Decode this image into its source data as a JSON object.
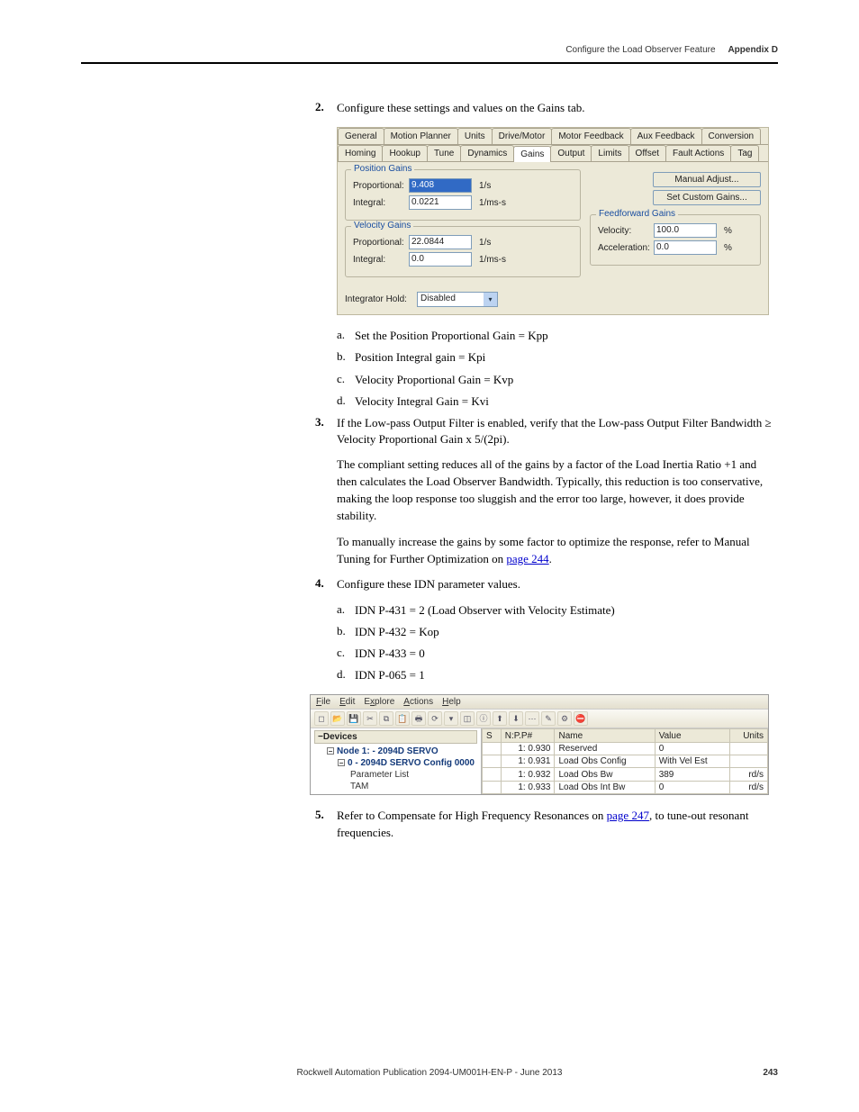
{
  "header": {
    "title": "Configure the Load Observer Feature",
    "section": "Appendix D"
  },
  "step2": {
    "num": "2.",
    "text": "Configure these settings and values on the Gains tab.",
    "a": {
      "label": "a.",
      "text": "Set the Position Proportional Gain = Kpp"
    },
    "b": {
      "label": "b.",
      "text": "Position Integral gain = Kpi"
    },
    "c": {
      "label": "c.",
      "text": "Velocity Proportional Gain = Kvp"
    },
    "d": {
      "label": "d.",
      "text": "Velocity Integral Gain = Kvi"
    }
  },
  "dlg1": {
    "tabs_row1": [
      "General",
      "Motion Planner",
      "Units",
      "Drive/Motor",
      "Motor Feedback",
      "Aux Feedback",
      "Conversion"
    ],
    "tabs_row2": [
      "Homing",
      "Hookup",
      "Tune",
      "Dynamics",
      "Gains",
      "Output",
      "Limits",
      "Offset",
      "Fault Actions",
      "Tag"
    ],
    "active_tab": "Gains",
    "pos": {
      "legend": "Position Gains",
      "prop_label": "Proportional:",
      "prop_value": "9.408",
      "prop_unit": "1/s",
      "int_label": "Integral:",
      "int_value": "0.0221",
      "int_unit": "1/ms-s"
    },
    "vel": {
      "legend": "Velocity Gains",
      "prop_label": "Proportional:",
      "prop_value": "22.0844",
      "prop_unit": "1/s",
      "int_label": "Integral:",
      "int_value": "0.0",
      "int_unit": "1/ms-s"
    },
    "btns": {
      "manual": "Manual Adjust...",
      "custom": "Set Custom Gains..."
    },
    "ff": {
      "legend": "Feedforward Gains",
      "vel_label": "Velocity:",
      "vel_value": "100.0",
      "vel_unit": "%",
      "acc_label": "Acceleration:",
      "acc_value": "0.0",
      "acc_unit": "%"
    },
    "ihold": {
      "label": "Integrator Hold:",
      "value": "Disabled"
    }
  },
  "step3": {
    "num": "3.",
    "text": "If the Low-pass Output Filter is enabled, verify that the Low-pass Output Filter Bandwidth ≥ Velocity Proportional Gain x 5/(2pi).",
    "p2": "The compliant setting reduces all of the gains by a factor of the Load Inertia Ratio +1 and then calculates the Load Observer Bandwidth. Typically, this reduction is too conservative, making the loop response too sluggish and the error too large, however, it does provide stability.",
    "p3_pre": "To manually increase the gains by some factor to optimize the response, refer to Manual Tuning for Further Optimization on ",
    "p3_link": "page 244",
    "p3_post": "."
  },
  "step4": {
    "num": "4.",
    "text": "Configure these IDN parameter values.",
    "a": {
      "label": "a.",
      "text": "IDN P-431 = 2 (Load Observer with Velocity Estimate)"
    },
    "b": {
      "label": "b.",
      "text": "IDN P-432 = Kop"
    },
    "c": {
      "label": "c.",
      "text": "IDN P-433 = 0"
    },
    "d": {
      "label": "d.",
      "text": "IDN P-065 = 1"
    }
  },
  "dlg2": {
    "menus": [
      "File",
      "Edit",
      "Explore",
      "Actions",
      "Help"
    ],
    "tree_head": "Devices",
    "tree": {
      "n1": "Node 1: - 2094D SERVO",
      "n2": "0  - 2094D SERVO Config 0000",
      "n3": "Parameter List",
      "n4": "TAM"
    },
    "cols": {
      "s": "S",
      "np": "N:P.P#",
      "name": "Name",
      "value": "Value",
      "units": "Units"
    },
    "rows": [
      {
        "np": "1: 0.930",
        "name": "Reserved",
        "value": "0",
        "units": ""
      },
      {
        "np": "1: 0.931",
        "name": "Load Obs Config",
        "value": "With Vel Est",
        "units": ""
      },
      {
        "np": "1: 0.932",
        "name": "Load Obs Bw",
        "value": "389",
        "units": "rd/s"
      },
      {
        "np": "1: 0.933",
        "name": "Load Obs Int Bw",
        "value": "0",
        "units": "rd/s"
      }
    ]
  },
  "step5": {
    "num": "5.",
    "pre": "Refer to Compensate for High Frequency Resonances on ",
    "link": "page 247",
    "post": ", to tune-out resonant frequencies."
  },
  "footer": {
    "pub": "Rockwell Automation Publication 2094-UM001H-EN-P - June 2013",
    "page": "243"
  }
}
